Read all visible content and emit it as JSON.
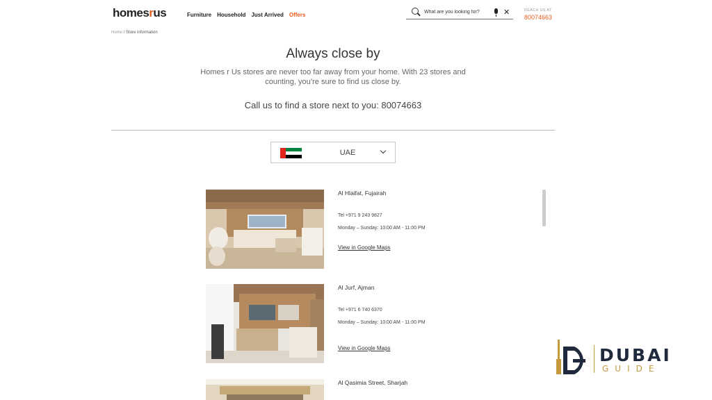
{
  "header": {
    "logo_text_a": "homes",
    "logo_text_r": "r",
    "logo_text_b": "us",
    "nav": [
      "Furniture",
      "Household",
      "Just Arrived",
      "Offers"
    ],
    "search_placeholder": "What are you looking for?",
    "reach_label": "REACH US AT",
    "reach_number": "80074663"
  },
  "breadcrumb": {
    "home": "Home",
    "sep": " / ",
    "current": "Store information"
  },
  "intro": {
    "title": "Always close by",
    "text": "Homes r Us stores are never too far away from your home. With 23 stores and counting, you’re sure to find us close by.",
    "call": "Call us to find a store next to you: 80074663"
  },
  "country_select": {
    "value": "UAE"
  },
  "stores": [
    {
      "name": "Al Hlaifat, Fujairah",
      "tel": "Tel +971 9 243 9827",
      "hours": "Monday – Sunday: 10:00 AM - 11:00 PM",
      "link": "View in Google Maps"
    },
    {
      "name": "Al Jurf, Ajman",
      "tel": "Tel +971 6 740 6370",
      "hours": "Monday – Sunday: 10:00 AM - 11:00 PM",
      "link": "View in Google Maps"
    },
    {
      "name": "Al Qasimia Street, Sharjah"
    }
  ],
  "watermark": {
    "line1": "DUBAI",
    "line2": "GUIDE"
  },
  "colors": {
    "accent": "#e65c1e",
    "brand_dark": "#1f2a3d",
    "gold": "#c49a3c"
  }
}
